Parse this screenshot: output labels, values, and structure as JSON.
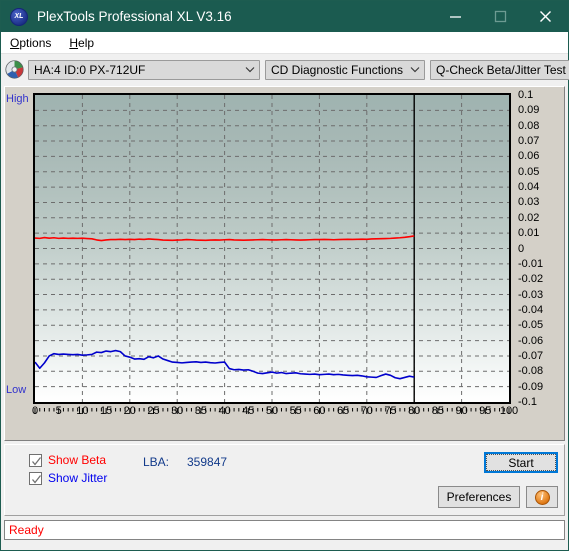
{
  "window": {
    "title": "PlexTools Professional XL V3.16",
    "logo_text": "XL",
    "minimize_label": "Minimize",
    "maximize_label": "Maximize",
    "close_label": "Close"
  },
  "menu": {
    "items": [
      {
        "label": "Options",
        "accel": "O"
      },
      {
        "label": "Help",
        "accel": "H"
      }
    ]
  },
  "toolbar": {
    "drive_combo": "HA:4 ID:0  PX-712UF",
    "function_combo": "CD Diagnostic Functions",
    "test_combo": "Q-Check Beta/Jitter Test"
  },
  "chart_labels": {
    "high": "High",
    "low": "Low"
  },
  "controls": {
    "show_beta": {
      "label": "Show Beta",
      "accel": "B",
      "checked": true,
      "color": "#ff0000"
    },
    "show_jitter": {
      "label": "Show Jitter",
      "accel": "J",
      "checked": true,
      "color": "#0000ee"
    },
    "lba_label": "LBA:",
    "lba_value": "359847",
    "start_label": "Start",
    "start_accel": "S",
    "preferences_label": "Preferences",
    "preferences_accel": "P",
    "info_label": "i"
  },
  "status": {
    "text": "Ready"
  },
  "chart_data": {
    "type": "line",
    "title": "Q-Check Beta/Jitter Test",
    "xlabel": "",
    "ylabel": "",
    "xlim": [
      0,
      100
    ],
    "ylim": [
      -0.1,
      0.1
    ],
    "grid": true,
    "legend": "none",
    "right_axis_ticks": [
      "0.1",
      "0.09",
      "0.08",
      "0.07",
      "0.06",
      "0.05",
      "0.04",
      "0.03",
      "0.02",
      "0.01",
      "0",
      "-0.01",
      "-0.02",
      "-0.03",
      "-0.04",
      "-0.05",
      "-0.06",
      "-0.07",
      "-0.08",
      "-0.09",
      "-0.1"
    ],
    "x_ticks": [
      0,
      5,
      10,
      15,
      20,
      25,
      30,
      35,
      40,
      45,
      50,
      55,
      60,
      65,
      70,
      75,
      80,
      85,
      90,
      95,
      100
    ],
    "left_axis_labels": [
      "High",
      "Low"
    ],
    "data_end_x": 80,
    "series": [
      {
        "name": "Beta",
        "color": "#ff0000",
        "x": [
          0,
          1,
          2,
          3,
          4,
          5,
          6,
          7,
          8,
          9,
          10,
          11,
          12,
          13,
          14,
          15,
          16,
          17,
          18,
          19,
          20,
          21,
          22,
          23,
          24,
          25,
          26,
          27,
          28,
          29,
          30,
          31,
          32,
          33,
          34,
          35,
          36,
          37,
          38,
          39,
          40,
          41,
          42,
          43,
          44,
          45,
          46,
          47,
          48,
          49,
          50,
          51,
          52,
          53,
          54,
          55,
          56,
          57,
          58,
          59,
          60,
          61,
          62,
          63,
          64,
          65,
          66,
          67,
          68,
          69,
          70,
          71,
          72,
          73,
          74,
          75,
          76,
          77,
          78,
          79,
          80
        ],
        "values": [
          0.0068,
          0.0066,
          0.0071,
          0.0067,
          0.007,
          0.0066,
          0.0068,
          0.0066,
          0.0067,
          0.0066,
          0.0067,
          0.0065,
          0.0063,
          0.0056,
          0.0052,
          0.0056,
          0.0058,
          0.0058,
          0.006,
          0.0058,
          0.006,
          0.0058,
          0.0061,
          0.0059,
          0.0062,
          0.006,
          0.0058,
          0.0055,
          0.0054,
          0.0053,
          0.0055,
          0.0056,
          0.0058,
          0.0057,
          0.0055,
          0.0054,
          0.0053,
          0.0055,
          0.0056,
          0.0055,
          0.0057,
          0.0058,
          0.0056,
          0.0055,
          0.0054,
          0.0055,
          0.0056,
          0.0057,
          0.0058,
          0.0057,
          0.0056,
          0.0056,
          0.0057,
          0.0058,
          0.0057,
          0.0056,
          0.0055,
          0.0056,
          0.0057,
          0.0058,
          0.0058,
          0.0059,
          0.0058,
          0.0057,
          0.0058,
          0.0059,
          0.006,
          0.0059,
          0.006,
          0.0061,
          0.006,
          0.0062,
          0.0063,
          0.0064,
          0.0065,
          0.0066,
          0.0068,
          0.007,
          0.0073,
          0.0077,
          0.0082
        ]
      },
      {
        "name": "Jitter",
        "color": "#0000cc",
        "x": [
          0,
          1,
          2,
          3,
          4,
          5,
          6,
          7,
          8,
          9,
          10,
          11,
          12,
          13,
          14,
          15,
          16,
          17,
          18,
          19,
          20,
          21,
          22,
          23,
          24,
          25,
          26,
          27,
          28,
          29,
          30,
          31,
          32,
          33,
          34,
          35,
          36,
          37,
          38,
          39,
          40,
          41,
          42,
          43,
          44,
          45,
          46,
          47,
          48,
          49,
          50,
          51,
          52,
          53,
          54,
          55,
          56,
          57,
          58,
          59,
          60,
          61,
          62,
          63,
          64,
          65,
          66,
          67,
          68,
          69,
          70,
          71,
          72,
          73,
          74,
          75,
          76,
          77,
          78,
          79,
          80
        ],
        "values": [
          -0.074,
          -0.078,
          -0.0745,
          -0.07,
          -0.0685,
          -0.069,
          -0.0688,
          -0.069,
          -0.0692,
          -0.069,
          -0.0695,
          -0.0693,
          -0.069,
          -0.0675,
          -0.0678,
          -0.0668,
          -0.0672,
          -0.0665,
          -0.0672,
          -0.07,
          -0.0708,
          -0.072,
          -0.0718,
          -0.0722,
          -0.0705,
          -0.0712,
          -0.07,
          -0.072,
          -0.073,
          -0.074,
          -0.0742,
          -0.0745,
          -0.0742,
          -0.074,
          -0.0738,
          -0.0742,
          -0.074,
          -0.0744,
          -0.0746,
          -0.0742,
          -0.074,
          -0.0782,
          -0.079,
          -0.0788,
          -0.0792,
          -0.079,
          -0.08,
          -0.0812,
          -0.0815,
          -0.081,
          -0.0805,
          -0.0812,
          -0.0808,
          -0.0815,
          -0.0812,
          -0.081,
          -0.0816,
          -0.0818,
          -0.082,
          -0.0818,
          -0.0822,
          -0.082,
          -0.0818,
          -0.0822,
          -0.082,
          -0.0824,
          -0.0826,
          -0.0828,
          -0.0826,
          -0.083,
          -0.0836,
          -0.0838,
          -0.084,
          -0.0828,
          -0.0818,
          -0.0826,
          -0.0842,
          -0.0848,
          -0.084,
          -0.0832,
          -0.0838
        ]
      }
    ]
  }
}
